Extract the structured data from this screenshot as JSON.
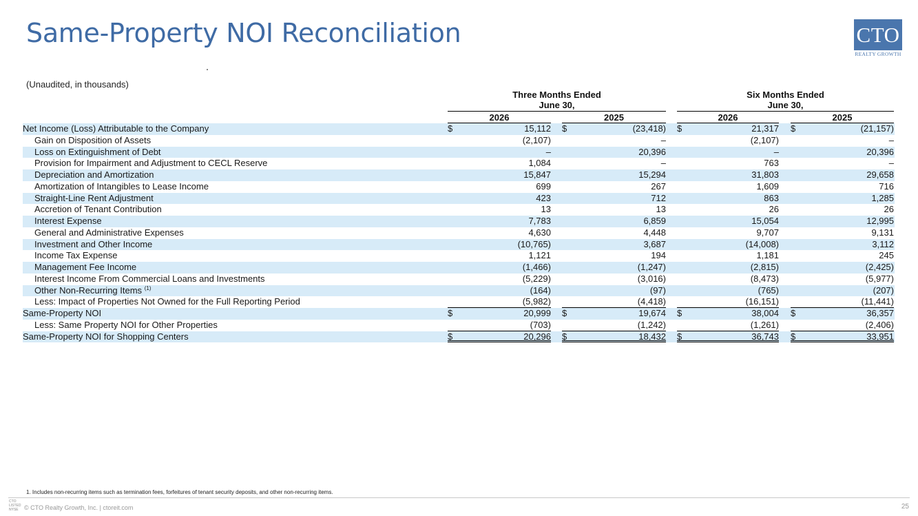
{
  "page": {
    "title": "Same-Property NOI Reconciliation",
    "logo_text": "CTO",
    "logo_sub": "REALTY GROWTH",
    "subtitle": "(Unaudited, in thousands)",
    "footnote": "1.    Includes non-recurring items such as termination fees, forfeitures of tenant security deposits, and other non-recurring items.",
    "copyright": "© CTO Realty Growth, Inc. | ctoreit.com",
    "page_number": "25",
    "footer_logo": "CTO\nLISTED\nNYSE"
  },
  "headers": {
    "three_months_line1": "Three Months Ended",
    "three_months_line2": "June 30,",
    "six_months_line1": "Six Months Ended",
    "six_months_line2": "June 30,",
    "years": [
      "2026",
      "2025",
      "2026",
      "2025"
    ]
  },
  "rows": [
    {
      "label": "Net Income (Loss) Attributable to the Company",
      "values": [
        "15,112",
        "(23,418)",
        "21,317",
        "(21,157)"
      ],
      "dollar": true,
      "indent": false,
      "shaded": true
    },
    {
      "label": "Gain on Disposition of Assets",
      "values": [
        "(2,107)",
        "–",
        "(2,107)",
        "–"
      ],
      "indent": true,
      "shaded": false
    },
    {
      "label": "Loss on Extinguishment of Debt",
      "values": [
        "–",
        "20,396",
        "–",
        "20,396"
      ],
      "indent": true,
      "shaded": true
    },
    {
      "label": "Provision for Impairment and Adjustment to CECL Reserve",
      "values": [
        "1,084",
        "–",
        "763",
        "–"
      ],
      "indent": true,
      "shaded": false
    },
    {
      "label": "Depreciation and Amortization",
      "values": [
        "15,847",
        "15,294",
        "31,803",
        "29,658"
      ],
      "indent": true,
      "shaded": true
    },
    {
      "label": "Amortization of Intangibles to Lease Income",
      "values": [
        "699",
        "267",
        "1,609",
        "716"
      ],
      "indent": true,
      "shaded": false
    },
    {
      "label": "Straight-Line Rent Adjustment",
      "values": [
        "423",
        "712",
        "863",
        "1,285"
      ],
      "indent": true,
      "shaded": true
    },
    {
      "label": "Accretion of Tenant Contribution",
      "values": [
        "13",
        "13",
        "26",
        "26"
      ],
      "indent": true,
      "shaded": false
    },
    {
      "label": "Interest Expense",
      "values": [
        "7,783",
        "6,859",
        "15,054",
        "12,995"
      ],
      "indent": true,
      "shaded": true
    },
    {
      "label": "General and Administrative Expenses",
      "values": [
        "4,630",
        "4,448",
        "9,707",
        "9,131"
      ],
      "indent": true,
      "shaded": false
    },
    {
      "label": "Investment and Other Income",
      "values": [
        "(10,765)",
        "3,687",
        "(14,008)",
        "3,112"
      ],
      "indent": true,
      "shaded": true
    },
    {
      "label": "Income Tax Expense",
      "values": [
        "1,121",
        "194",
        "1,181",
        "245"
      ],
      "indent": true,
      "shaded": false
    },
    {
      "label": "Management Fee Income",
      "values": [
        "(1,466)",
        "(1,247)",
        "(2,815)",
        "(2,425)"
      ],
      "indent": true,
      "shaded": true
    },
    {
      "label": "Interest Income From Commercial Loans and Investments",
      "values": [
        "(5,229)",
        "(3,016)",
        "(8,473)",
        "(5,977)"
      ],
      "indent": true,
      "shaded": false
    },
    {
      "label": "Other Non-Recurring Items",
      "sup": "(1)",
      "values": [
        "(164)",
        "(97)",
        "(765)",
        "(207)"
      ],
      "indent": true,
      "shaded": true
    },
    {
      "label": "Less: Impact of Properties Not Owned for the Full Reporting Period",
      "values": [
        "(5,982)",
        "(4,418)",
        "(16,151)",
        "(11,441)"
      ],
      "indent": true,
      "shaded": false,
      "underline": 1
    },
    {
      "label": "Same-Property NOI",
      "values": [
        "20,999",
        "19,674",
        "38,004",
        "36,357"
      ],
      "dollar": true,
      "indent": false,
      "shaded": true
    },
    {
      "label": "Less: Same Property NOI for Other Properties",
      "values": [
        "(703)",
        "(1,242)",
        "(1,261)",
        "(2,406)"
      ],
      "indent": true,
      "shaded": false,
      "underline": 1
    },
    {
      "label": "Same-Property NOI for Shopping Centers",
      "values": [
        "20,296",
        "18,432",
        "36,743",
        "33,951"
      ],
      "dollar": true,
      "indent": false,
      "shaded": true,
      "underline": 2
    }
  ],
  "dollar_sign": "$"
}
